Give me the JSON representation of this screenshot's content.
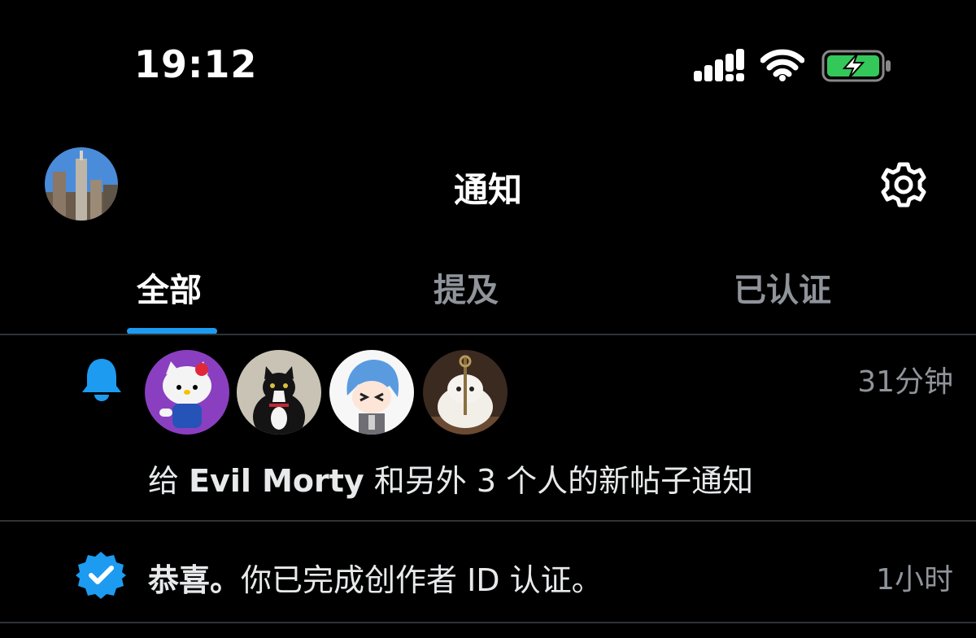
{
  "status_bar": {
    "time": "19:12"
  },
  "header": {
    "title": "通知",
    "avatar_icon": "profile-avatar",
    "settings_icon": "gear-icon"
  },
  "tabs": [
    {
      "label": "全部",
      "active": true
    },
    {
      "label": "提及",
      "active": false
    },
    {
      "label": "已认证",
      "active": false
    }
  ],
  "colors": {
    "accent": "#1d9bf0",
    "muted": "#8f939a",
    "battery": "#34c759"
  },
  "notifications": [
    {
      "icon": "bell-icon",
      "time": "31分钟",
      "text_prefix": "给 ",
      "name": "Evil Morty",
      "text_suffix": " 和另外 3 个人的新帖子通知",
      "avatars": [
        "hello-kitty-avatar",
        "cat-avatar",
        "anime-avatar",
        "hamster-avatar"
      ]
    },
    {
      "icon": "verified-badge-icon",
      "time": "1小时",
      "title": "恭喜。",
      "text": "你已完成创作者 ID 认证。"
    }
  ]
}
